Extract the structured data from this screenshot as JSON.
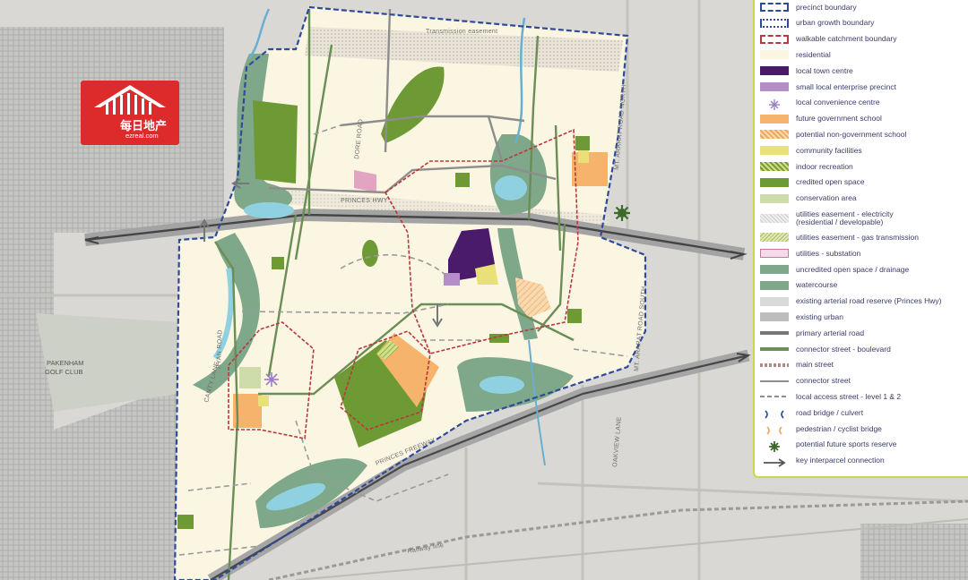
{
  "logo": {
    "name": "每日地产",
    "domain": "ezreal.com"
  },
  "labels": {
    "transmission_easement": "Transmission easement",
    "dore_road": "DORE ROAD",
    "mt_ararat_north": "MT. ARARAT ROAD NORTH",
    "mt_ararat_south": "MT. ARARAT ROAD SOUTH",
    "pakenham_golf_club_1": "PAKENHAM",
    "pakenham_golf_club_2": "GOLF CLUB",
    "canty_lane": "CANTY LANE",
    "princes_freeway": "PRINCES FREEWAY",
    "oakview_lane": "OAKVIEW LANE",
    "railway_line": "Railway line",
    "princes_hwy": "PRINCES HWY",
    "ryan_road": "RYAN ROAD"
  },
  "legend": [
    {
      "label": "precinct boundary",
      "swatch": "precinct-boundary"
    },
    {
      "label": "urban growth boundary",
      "swatch": "urban-growth-boundary"
    },
    {
      "label": "walkable catchment boundary",
      "swatch": "walkable-catchment"
    },
    {
      "label": "residential",
      "swatch": "residential"
    },
    {
      "label": "local town centre",
      "swatch": "town-centre"
    },
    {
      "label": "small local enterprise precinct",
      "swatch": "enterprise"
    },
    {
      "label": "local convenience centre",
      "swatch": "convenience"
    },
    {
      "label": "future government school",
      "swatch": "gov-school"
    },
    {
      "label": "potential non-government school",
      "swatch": "non-gov-school"
    },
    {
      "label": "community facilities",
      "swatch": "community"
    },
    {
      "label": "indoor recreation",
      "swatch": "indoor-rec"
    },
    {
      "label": "credited open space",
      "swatch": "credited-open"
    },
    {
      "label": "conservation area",
      "swatch": "conservation"
    },
    {
      "label": "utilities easement - electricity\n(residential / developable)",
      "swatch": "elec-easement"
    },
    {
      "label": "utilities easement - gas transmission",
      "swatch": "gas-easement"
    },
    {
      "label": "utilities - substation",
      "swatch": "substation"
    },
    {
      "label": "uncredited open space / drainage",
      "swatch": "uncredited"
    },
    {
      "label": "watercourse",
      "swatch": "watercourse"
    },
    {
      "label": "existing arterial road reserve (Princes Hwy)",
      "swatch": "arterial-reserve"
    },
    {
      "label": "existing urban",
      "swatch": "existing-urban"
    },
    {
      "label": "primary arterial road",
      "swatch": "primary-arterial"
    },
    {
      "label": "connector street - boulevard",
      "swatch": "boulevard"
    },
    {
      "label": "main street",
      "swatch": "main-street"
    },
    {
      "label": "connector street",
      "swatch": "connector"
    },
    {
      "label": "local access street - level 1 & 2",
      "swatch": "local-access"
    },
    {
      "label": "road bridge / culvert",
      "swatch": "road-bridge"
    },
    {
      "label": "pedestrian / cyclist bridge",
      "swatch": "ped-bridge"
    },
    {
      "label": "potential future sports reserve",
      "swatch": "sports-reserve"
    },
    {
      "label": "key interparcel connection",
      "swatch": "interparcel"
    }
  ],
  "colors": {
    "precinct_boundary": "#2f4a9a",
    "walkable": "#b9383f",
    "residential": "#fbf6e2",
    "town_centre": "#4a1a6b",
    "enterprise": "#b58ec8",
    "gov_school": "#f6b36b",
    "community": "#e9e07a",
    "credited_open": "#6e9a35",
    "conservation": "#cddca8",
    "uncredited": "#7fa78a",
    "water": "#8fd1e0",
    "connector": "#6b8d56",
    "road": "#7b7b7b",
    "existing_urban": "#b9b9b9",
    "background": "#d9d8d4"
  }
}
